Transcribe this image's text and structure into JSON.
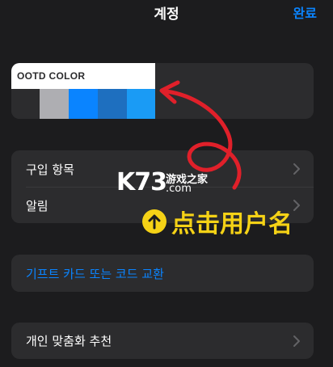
{
  "nav": {
    "title": "계정",
    "done": "완료"
  },
  "account_card": {
    "label": "OOTD COLOR",
    "swatches": [
      "#2c2c2e",
      "#aeaeb2",
      "#0a84ff",
      "#1e6fbf",
      "#1a9bf5"
    ]
  },
  "group1": {
    "items": [
      {
        "label": "구입 항목"
      },
      {
        "label": "알림"
      }
    ]
  },
  "group2": {
    "items": [
      {
        "label": "기프트 카드 또는 코드 교환"
      }
    ]
  },
  "group3": {
    "items": [
      {
        "label": "개인 맞춤화 추천"
      }
    ]
  },
  "watermark": {
    "logo": "K73",
    "text": "游戏之家",
    "com": ".com"
  },
  "annotation": {
    "text": "点击用户名",
    "color": "#f5d216",
    "arrow_color": "#e0202a"
  }
}
